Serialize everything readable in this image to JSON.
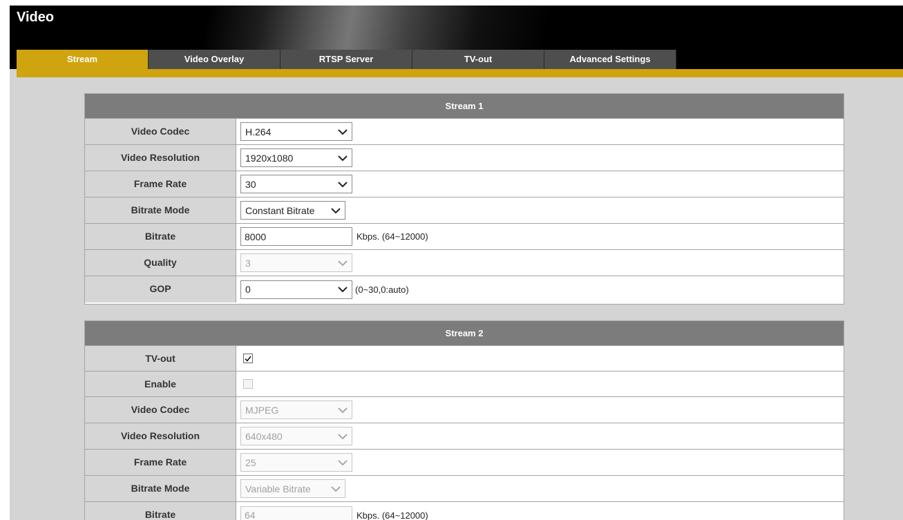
{
  "page": {
    "title": "Video"
  },
  "tabs": [
    {
      "label": "Stream",
      "active": true
    },
    {
      "label": "Video Overlay",
      "active": false
    },
    {
      "label": "RTSP Server",
      "active": false
    },
    {
      "label": "TV-out",
      "active": false
    },
    {
      "label": "Advanced Settings",
      "active": false
    }
  ],
  "colors": {
    "accent": "#cfa40e",
    "tab_bg": "#4e4e4e",
    "section_header": "#7c7c7c",
    "label_bg": "#d6d6d6"
  },
  "stream1": {
    "title": "Stream 1",
    "video_codec": {
      "label": "Video Codec",
      "value": "H.264"
    },
    "video_resolution": {
      "label": "Video Resolution",
      "value": "1920x1080"
    },
    "frame_rate": {
      "label": "Frame Rate",
      "value": "30"
    },
    "bitrate_mode": {
      "label": "Bitrate Mode",
      "value": "Constant Bitrate"
    },
    "bitrate": {
      "label": "Bitrate",
      "value": "8000",
      "hint": "Kbps. (64~12000)"
    },
    "quality": {
      "label": "Quality",
      "value": "3",
      "disabled": true
    },
    "gop": {
      "label": "GOP",
      "value": "0",
      "hint": "(0~30,0:auto)"
    }
  },
  "stream2": {
    "title": "Stream 2",
    "tv_out": {
      "label": "TV-out",
      "checked": true
    },
    "enable": {
      "label": "Enable",
      "checked": false,
      "disabled": true
    },
    "video_codec": {
      "label": "Video Codec",
      "value": "MJPEG",
      "disabled": true
    },
    "video_resolution": {
      "label": "Video Resolution",
      "value": "640x480",
      "disabled": true
    },
    "frame_rate": {
      "label": "Frame Rate",
      "value": "25",
      "disabled": true
    },
    "bitrate_mode": {
      "label": "Bitrate Mode",
      "value": "Variable Bitrate",
      "disabled": true
    },
    "bitrate": {
      "label": "Bitrate",
      "value": "64",
      "hint": "Kbps. (64~12000)",
      "disabled": true
    }
  }
}
